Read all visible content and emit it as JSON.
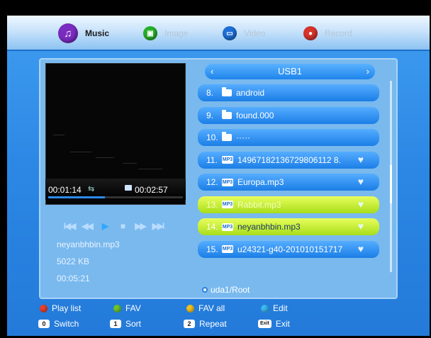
{
  "tabs": [
    {
      "label": "Music",
      "icon": "music-note-icon",
      "color": "#7a2cc0",
      "active": true
    },
    {
      "label": "Image",
      "icon": "image-icon",
      "color": "#27b02a",
      "active": false
    },
    {
      "label": "Video",
      "icon": "video-icon",
      "color": "#1e6fd6",
      "active": false
    },
    {
      "label": "Record",
      "icon": "record-icon",
      "color": "#d8342c",
      "active": false
    }
  ],
  "player": {
    "time_current": "00:01:14",
    "time_total": "00:02:57",
    "progress": 0.42,
    "controls": [
      "I◀◀",
      "◀◀",
      "▶",
      "■",
      "▶▶",
      "▶▶I"
    ],
    "filename": "neyanbhbin.mp3",
    "filesize": "5022 KB",
    "duration": "00:05:21"
  },
  "browser": {
    "title": "USB1",
    "prev": "‹",
    "next": "›",
    "path": "uda1/Root",
    "rows": [
      {
        "num": "8.",
        "type": "folder",
        "name": "android"
      },
      {
        "num": "9.",
        "type": "folder",
        "name": "found.000"
      },
      {
        "num": "10.",
        "type": "folder",
        "name": "·····"
      },
      {
        "num": "11.",
        "type": "mp3",
        "name": "14967182136729806112 8.",
        "fav": true
      },
      {
        "num": "12.",
        "type": "mp3",
        "name": "Europa.mp3",
        "fav": true
      },
      {
        "num": "13.",
        "type": "mp3",
        "name": "Rabbit.mp3",
        "fav": true,
        "selected": true,
        "dim": true
      },
      {
        "num": "14.",
        "type": "mp3",
        "name": "neyanbhbin.mp3",
        "fav": true,
        "selected": true
      },
      {
        "num": "15.",
        "type": "mp3",
        "name": "u24321-g40-201010151717",
        "fav": true
      }
    ],
    "scroll": {
      "position": 0.55,
      "size": 0.2
    }
  },
  "hints": {
    "playlist": "Play list",
    "fav": "FAV",
    "fav_all": "FAV all",
    "edit": "Edit",
    "switch_key": "0",
    "switch": "Switch",
    "sort_key": "1",
    "sort": "Sort",
    "repeat_key": "2",
    "repeat": "Repeat",
    "exit_key": "Exit",
    "exit": "Exit",
    "colors": {
      "red": "#e8402c",
      "green": "#6cc62a",
      "yellow": "#f2c21c",
      "blue": "#3db8f0"
    }
  },
  "mp3_badge": "MP3",
  "heart_glyph": "♥"
}
